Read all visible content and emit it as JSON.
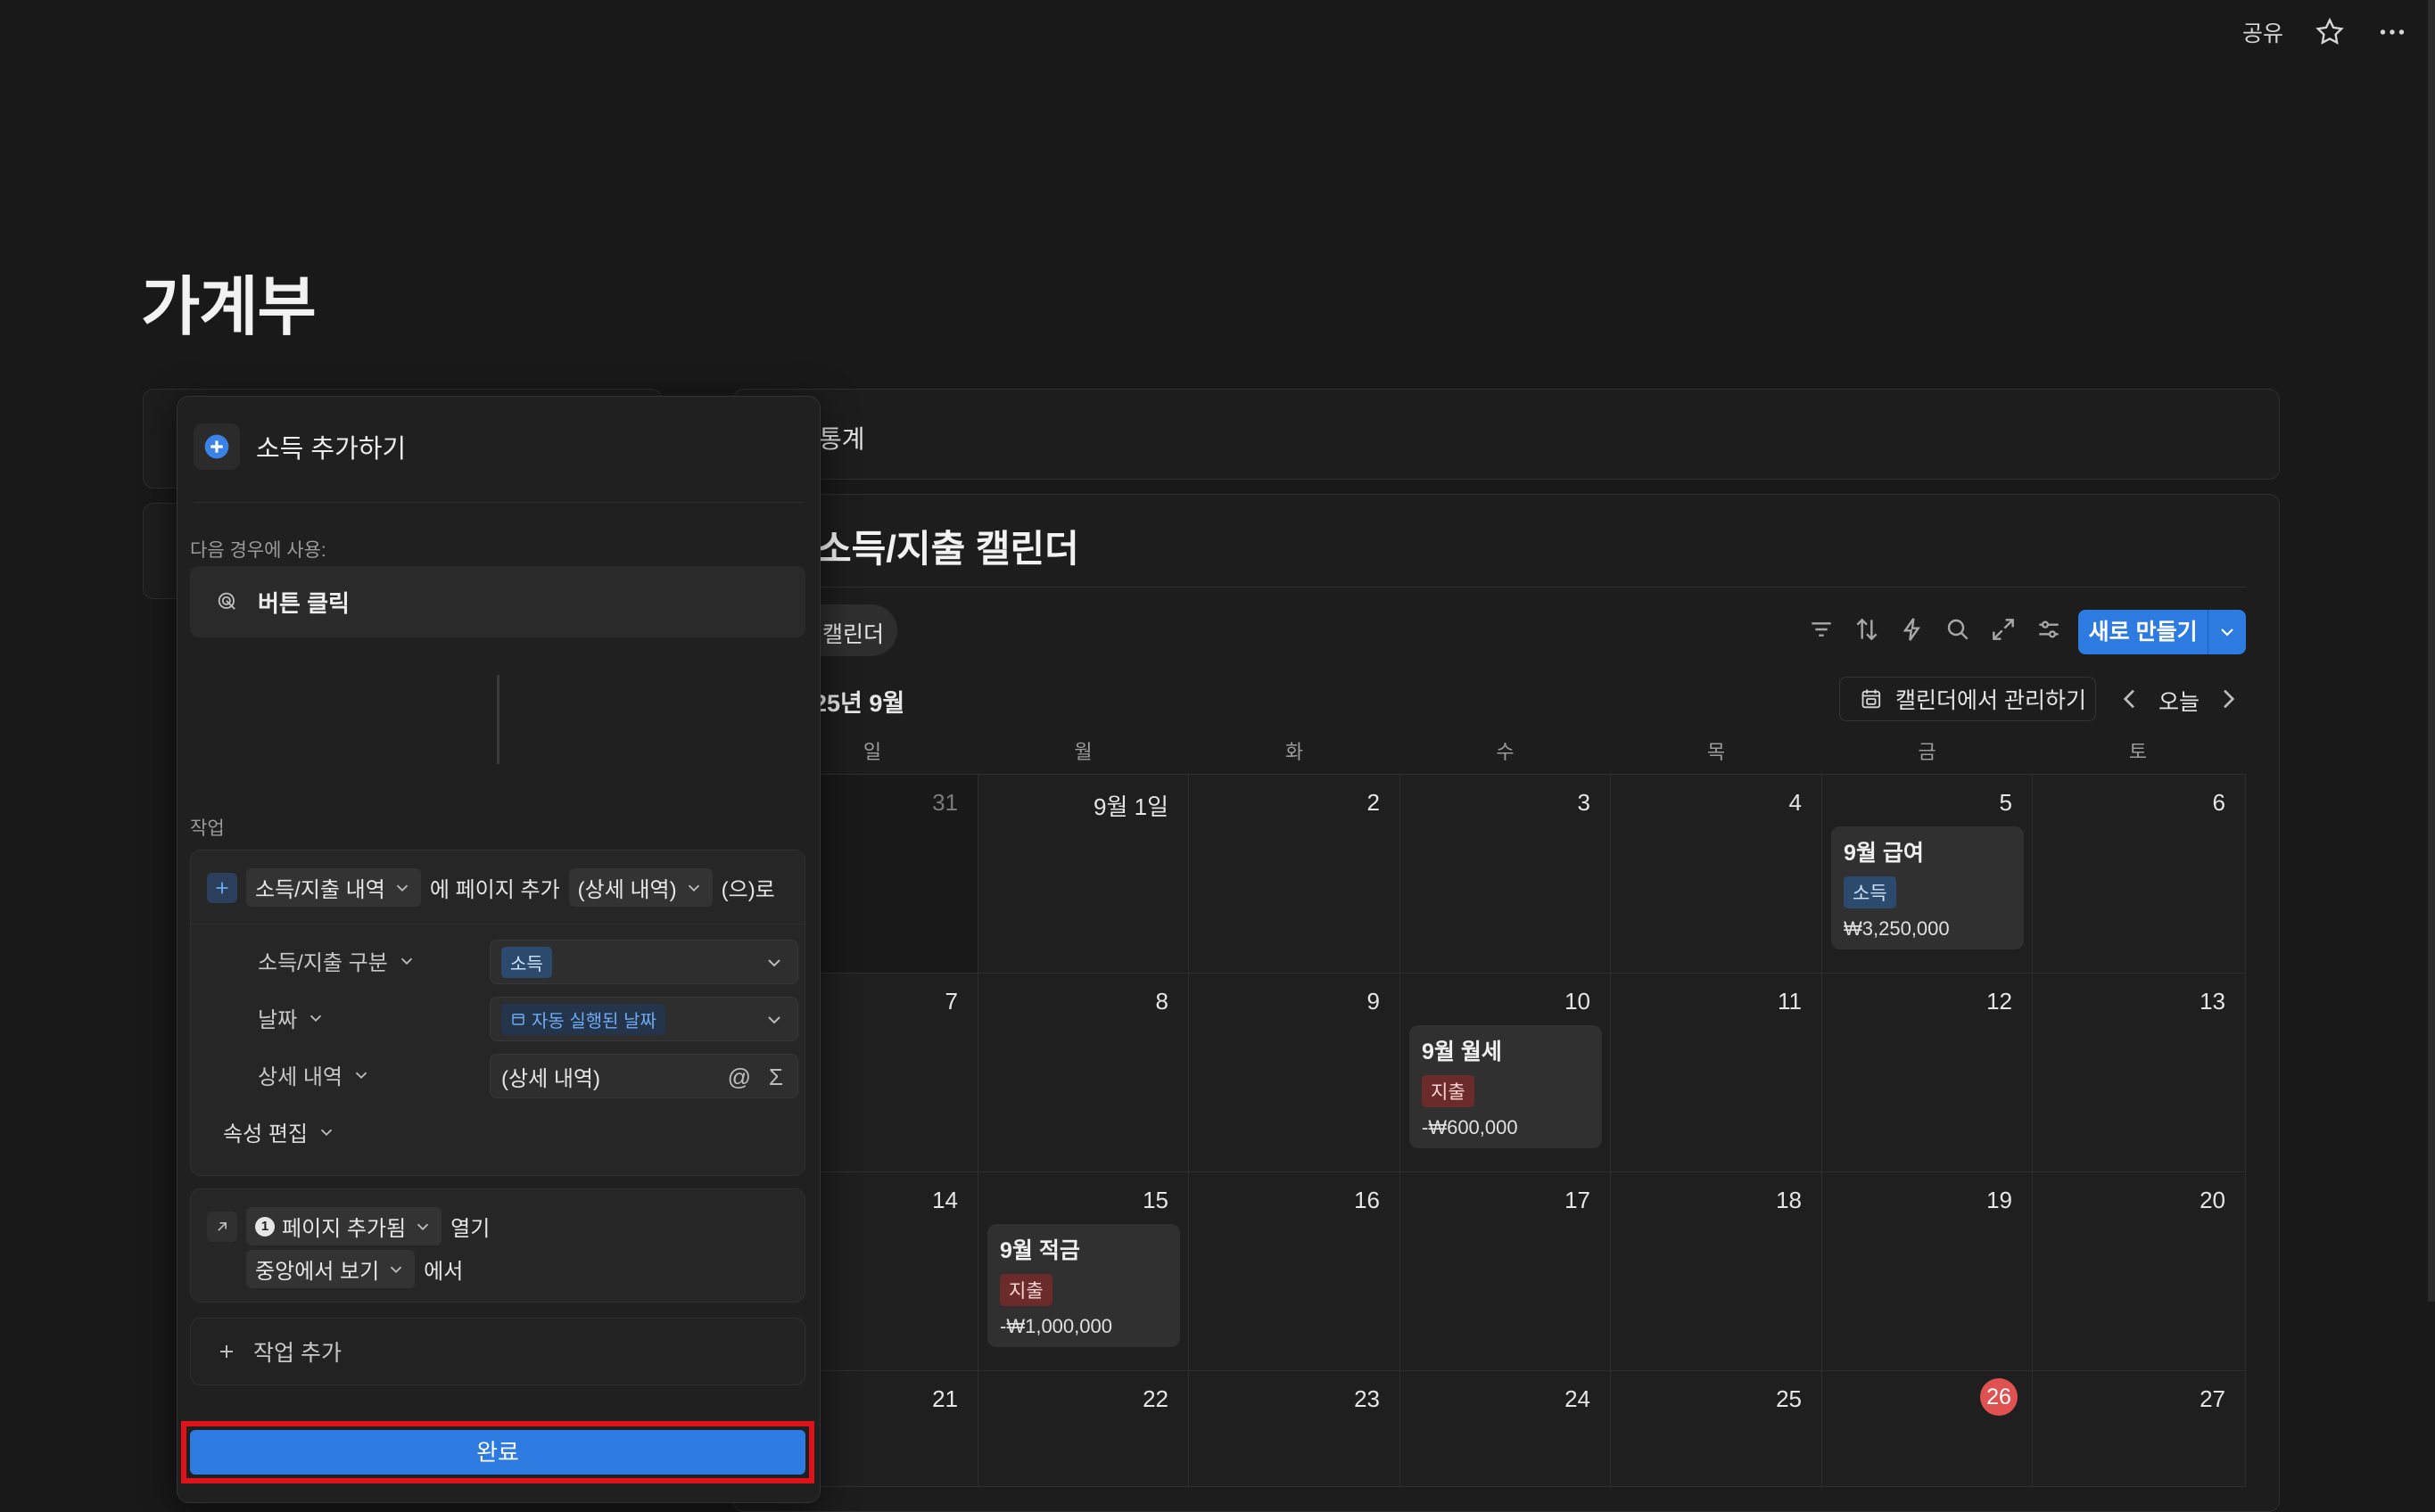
{
  "topbar": {
    "share": "공유"
  },
  "page": {
    "title": "가계부"
  },
  "stats": {
    "title": "통계"
  },
  "calendar": {
    "title": "소득/지출 캘린더",
    "view_tab": "캘린더",
    "new_button": "새로 만들기",
    "month_label": "25년 9월",
    "manage_button": "캘린더에서 관리하기",
    "today_button": "오늘",
    "weekdays": [
      "일",
      "월",
      "화",
      "수",
      "목",
      "금",
      "토"
    ],
    "today_date": "26",
    "days": [
      "31",
      "9월 1일",
      "2",
      "3",
      "4",
      "5",
      "6",
      "7",
      "8",
      "9",
      "10",
      "11",
      "12",
      "13",
      "14",
      "15",
      "16",
      "17",
      "18",
      "19",
      "20",
      "21",
      "22",
      "23",
      "24",
      "25",
      "26",
      "27"
    ],
    "events": [
      {
        "title": "9월 급여",
        "tag": "소득",
        "amount": "₩3,250,000"
      },
      {
        "title": "9월 월세",
        "tag": "지출",
        "amount": "-₩600,000"
      },
      {
        "title": "9월 적금",
        "tag": "지출",
        "amount": "-₩1,000,000"
      }
    ]
  },
  "panel": {
    "title": "소득 추가하기",
    "trigger_label": "다음 경우에 사용:",
    "trigger_value": "버튼 클릭",
    "actions_label": "작업",
    "action1": {
      "db": "소득/지출 내역",
      "text1": "에 페이지 추가",
      "page": "(상세 내역)",
      "text2": "(으)로",
      "props": [
        {
          "name": "소득/지출 구분",
          "value": "소득"
        },
        {
          "name": "날짜",
          "value": "자동 실행된 날짜"
        },
        {
          "name": "상세 내역",
          "value": "(상세 내역)"
        }
      ],
      "edit_props": "속성 편집"
    },
    "action2": {
      "badge": "1",
      "chip": "페이지 추가됨",
      "text1": "열기",
      "mode": "중앙에서 보기",
      "text2": "에서"
    },
    "add_action": "작업 추가",
    "done": "완료"
  }
}
